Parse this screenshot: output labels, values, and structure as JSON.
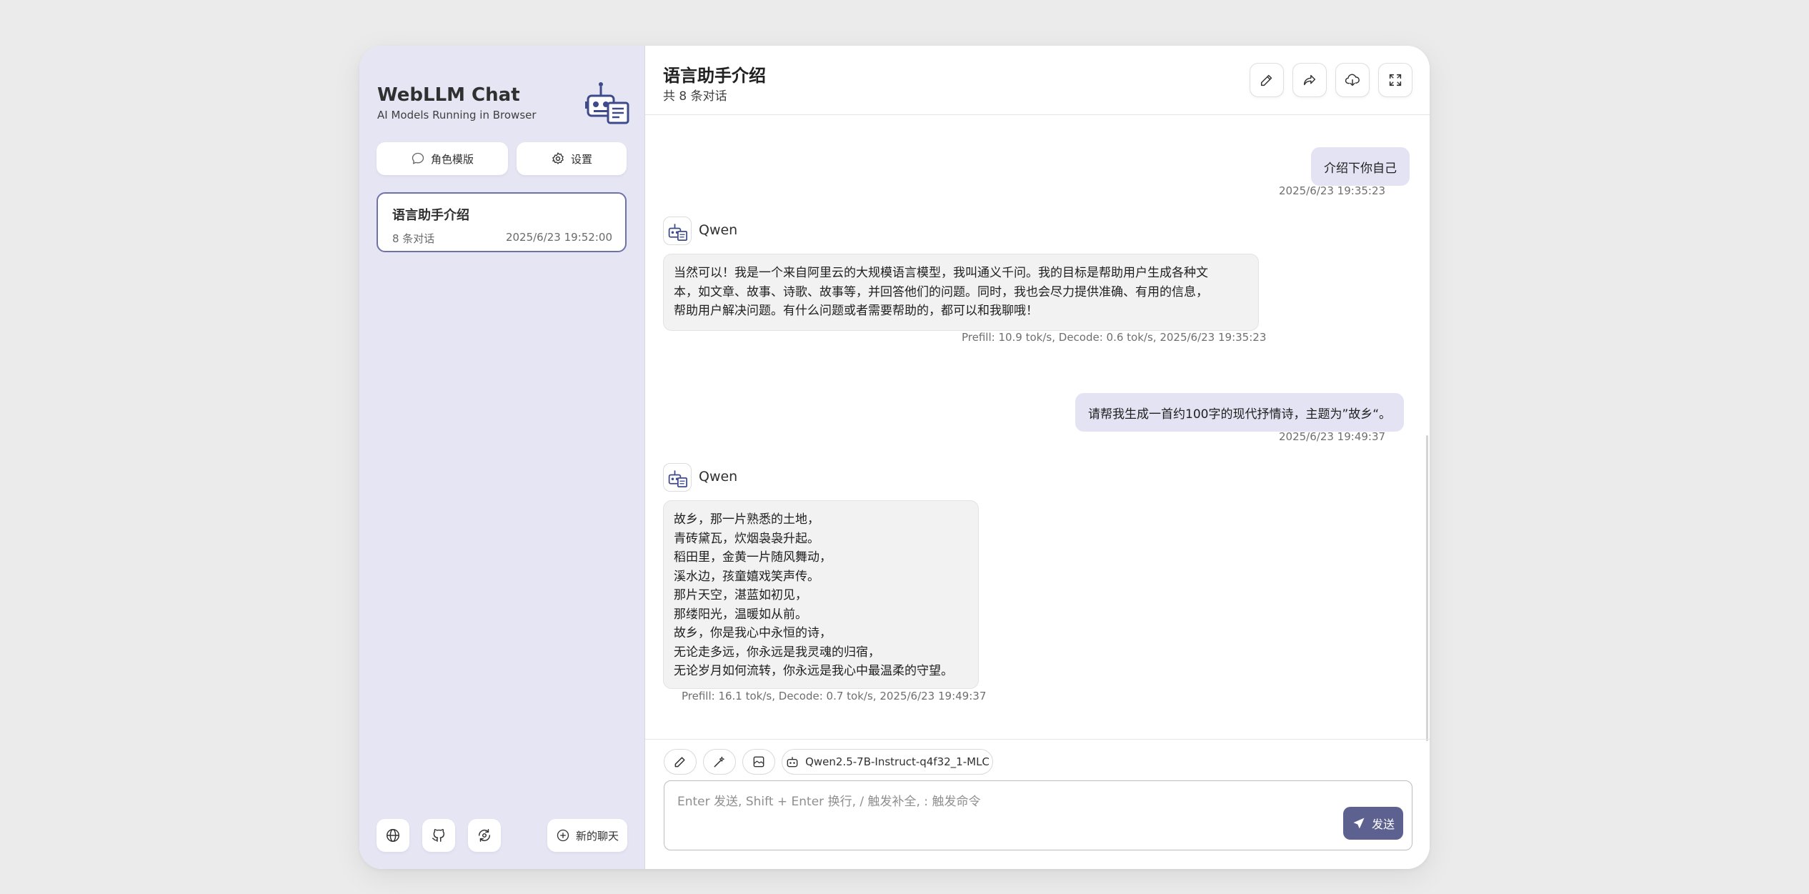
{
  "sidebar": {
    "brand_title": "WebLLM Chat",
    "brand_subtitle": "AI Models Running in Browser",
    "mask_button": "角色模版",
    "settings_button": "设置",
    "chats": [
      {
        "title": "语言助手介绍",
        "count": "8 条对话",
        "date": "2025/6/23 19:52:00"
      }
    ],
    "new_chat_button": "新的聊天",
    "footer_icons": [
      "globe-icon",
      "github-icon",
      "sync-icon"
    ]
  },
  "header": {
    "title": "语言助手介绍",
    "subtitle": "共 8 条对话",
    "actions": [
      "edit-icon",
      "share-icon",
      "download-icon",
      "fullscreen-icon"
    ]
  },
  "messages": [
    {
      "role": "user",
      "text": "介绍下你自己",
      "time": "2025/6/23 19:35:23"
    },
    {
      "role": "assistant",
      "name": "Qwen",
      "lines": [
        "当然可以！我是一个来自阿里云的大规模语言模型，我叫通义千问。我的目标是帮助用户生成各种文",
        "本，如文章、故事、诗歌、故事等，并回答他们的问题。同时，我也会尽力提供准确、有用的信息，",
        "帮助用户解决问题。有什么问题或者需要帮助的，都可以和我聊哦！"
      ],
      "stats": "Prefill: 10.9 tok/s,  Decode: 0.6 tok/s,  2025/6/23 19:35:23"
    },
    {
      "role": "user",
      "text": "请帮我生成一首约100字的现代抒情诗，主题为”故乡“。",
      "time": "2025/6/23 19:49:37"
    },
    {
      "role": "assistant",
      "name": "Qwen",
      "lines": [
        "故乡，那一片熟悉的土地，",
        "青砖黛瓦，炊烟袅袅升起。",
        "稻田里，金黄一片随风舞动，",
        "溪水边，孩童嬉戏笑声传。",
        "那片天空，湛蓝如初见，",
        "那缕阳光，温暖如从前。",
        "故乡，你是我心中永恒的诗，",
        "无论走多远，你永远是我灵魂的归宿，",
        "无论岁月如何流转，你永远是我心中最温柔的守望。"
      ],
      "stats": "Prefill: 16.1 tok/s,  Decode: 0.7 tok/s,  2025/6/23 19:49:37"
    }
  ],
  "input": {
    "model_chip": "Qwen2.5-7B-Instruct-q4f32_1-MLC",
    "placeholder": "Enter 发送, Shift + Enter 换行, / 触发补全, : 触发命令",
    "send_button": "发送",
    "tool_icons": [
      "brush-icon",
      "wand-icon",
      "image-icon",
      "robot-icon"
    ]
  },
  "colors": {
    "accent": "#5c6190",
    "sidebar_bg": "#e5e5f3",
    "user_bubble": "#e3e3f3",
    "bot_bubble": "#f2f2f2"
  }
}
